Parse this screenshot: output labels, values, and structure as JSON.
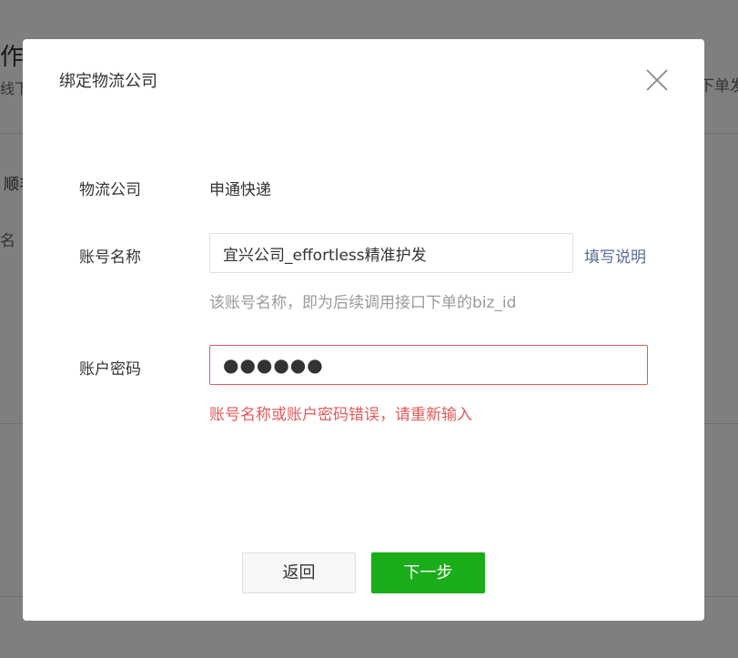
{
  "background": {
    "title_left": "作",
    "subtitle_left": "线下",
    "title_right": "下单发",
    "tab_left": "顺丰",
    "name_left": "名"
  },
  "dialog": {
    "title": "绑定物流公司",
    "fields": {
      "company": {
        "label": "物流公司",
        "value": "申通快递"
      },
      "account": {
        "label": "账号名称",
        "value": "宜兴公司_effortless精准护发",
        "help_link": "填写说明",
        "hint": "该账号名称，即为后续调用接口下单的biz_id"
      },
      "password": {
        "label": "账户密码",
        "value": "●●●●●●",
        "error": "账号名称或账户密码错误，请重新输入"
      }
    },
    "buttons": {
      "back": "返回",
      "next": "下一步"
    }
  },
  "colors": {
    "accent": "#1aad19",
    "error": "#e15a5a",
    "link": "#576b95"
  }
}
